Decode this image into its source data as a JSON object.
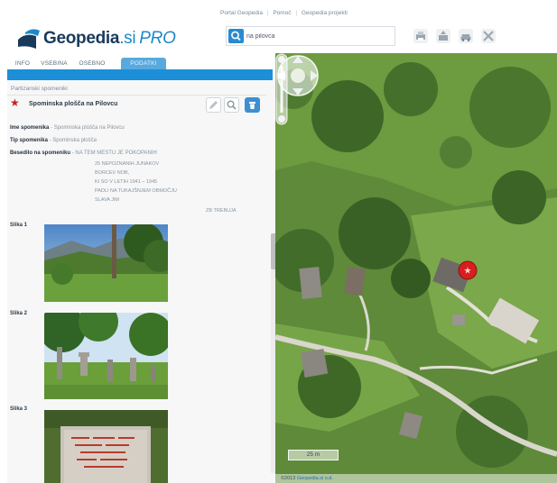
{
  "header": {
    "links": [
      "Portal Geopedia",
      "Pomoč",
      "Geopedia projekti"
    ],
    "logo": {
      "name": "Geopedia",
      "domain": ".si",
      "edition": "PRO"
    },
    "search": {
      "value": "na pilovca",
      "placeholder": ""
    },
    "tools": [
      "print-icon",
      "share-icon",
      "car-icon",
      "tools-icon"
    ]
  },
  "tabs": [
    {
      "label": "INFO",
      "active": false
    },
    {
      "label": "VSEBINA",
      "active": false
    },
    {
      "label": "OSEBNO",
      "active": false
    },
    {
      "label": "PODATKI",
      "active": true
    }
  ],
  "panel": {
    "breadcrumb": "Partizanski spomeniki",
    "title": "Spominska plošča na Pilovcu",
    "fields": [
      {
        "label": "Ime spomenika",
        "value": "Spominska plošča na Pilovcu"
      },
      {
        "label": "Tip spomenika",
        "value": "Spominska plošča"
      },
      {
        "label": "Besedilo na spomeniku",
        "value": "NA TEM MESTU JE POKOPANIH"
      }
    ],
    "inscription_lines": [
      "25 NEPOZNANIH JUNAKOV",
      "BORCEV NOB,",
      "KI SO V LETIH 1941 – 1945",
      "PADLI NA TUKAJŠNJEM OBMOČJU",
      "SLAVA JIM"
    ],
    "more_label": "ZB TREBUJA",
    "images": [
      {
        "label": "Slika 1",
        "scene": "mountain-meadow"
      },
      {
        "label": "Slika 2",
        "scene": "cemetery-grove"
      },
      {
        "label": "Slika 3",
        "scene": "stone-plaque"
      }
    ]
  },
  "map": {
    "scale_label": "25 m",
    "copyright_prefix": "©2013",
    "copyright_link": "Geopedia.si o.d."
  },
  "colors": {
    "brand_blue": "#1c8fd8",
    "marker_red": "#d81e1e",
    "star_red": "#c0261e",
    "logo_navy": "#1a3a5c"
  }
}
